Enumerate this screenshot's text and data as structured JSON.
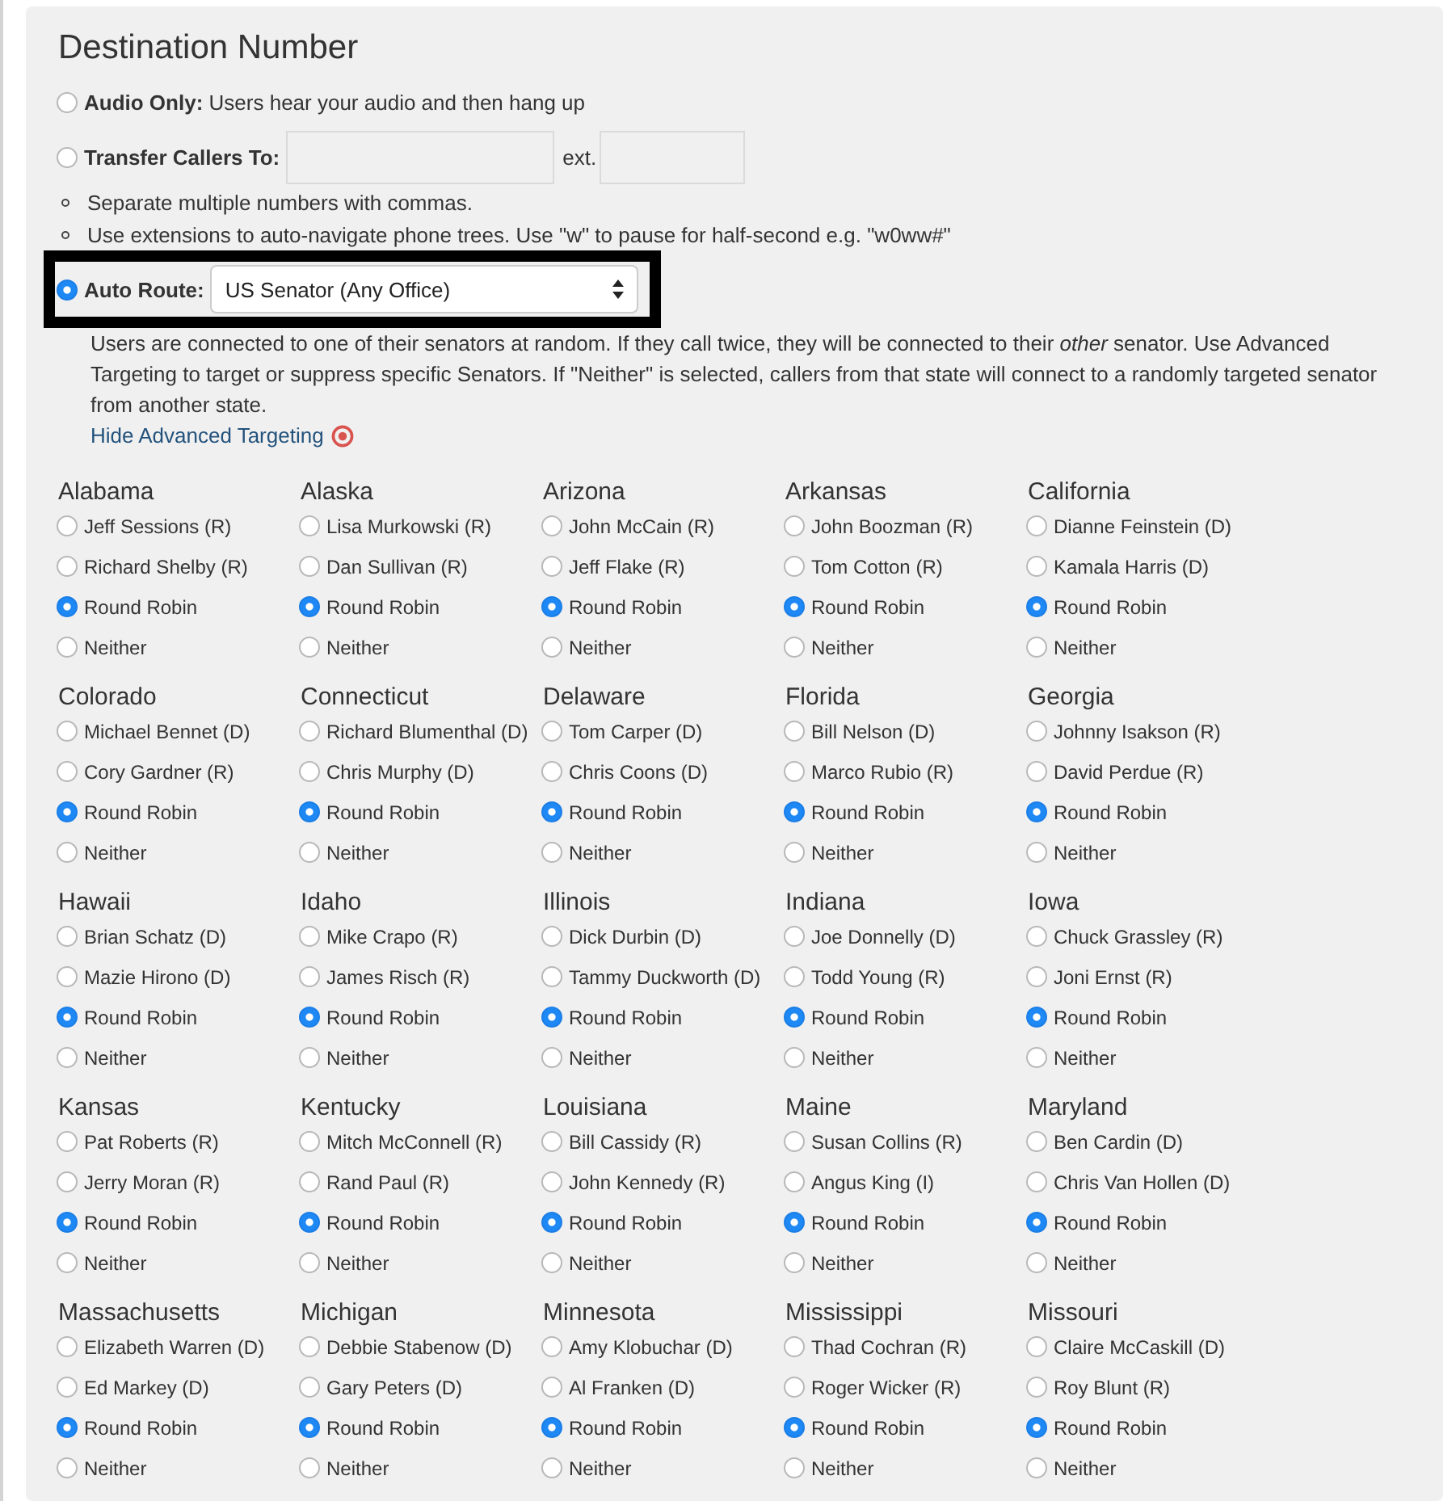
{
  "title": "Destination Number",
  "options": [
    {
      "kind": "plain",
      "label": "Audio Only:",
      "text": "Users hear your audio and then hang up",
      "selected": false
    },
    {
      "kind": "transfer",
      "label": "Transfer Callers To:",
      "ext_label": "ext.",
      "selected": false,
      "notes": [
        "Separate multiple numbers with commas.",
        "Use extensions to auto-navigate phone trees. Use \"w\" to pause for half-second e.g. \"w0ww#\""
      ]
    },
    {
      "kind": "select",
      "label": "Auto Route:",
      "value": "US Senator (Any Office)",
      "selected": true,
      "highlighted": true
    }
  ],
  "description": "Users are connected to one of their senators at random. If they call twice, they will be connected to their *other* senator. Use Advanced Targeting to target or suppress specific Senators. If \"Neither\" is selected, callers from that state will connect to a randomly targeted senator from another state.",
  "targeting_link": "Hide Advanced Targeting",
  "states": [
    {
      "name": "Alabama",
      "choices": [
        {
          "label": "Jeff Sessions (R)",
          "selected": false
        },
        {
          "label": "Richard Shelby (R)",
          "selected": false
        },
        {
          "label": "Round Robin",
          "selected": true
        },
        {
          "label": "Neither",
          "selected": false
        }
      ]
    },
    {
      "name": "Alaska",
      "choices": [
        {
          "label": "Lisa Murkowski (R)",
          "selected": false
        },
        {
          "label": "Dan Sullivan (R)",
          "selected": false
        },
        {
          "label": "Round Robin",
          "selected": true
        },
        {
          "label": "Neither",
          "selected": false
        }
      ]
    },
    {
      "name": "Arizona",
      "choices": [
        {
          "label": "John McCain (R)",
          "selected": false
        },
        {
          "label": "Jeff Flake (R)",
          "selected": false
        },
        {
          "label": "Round Robin",
          "selected": true
        },
        {
          "label": "Neither",
          "selected": false
        }
      ]
    },
    {
      "name": "Arkansas",
      "choices": [
        {
          "label": "John Boozman (R)",
          "selected": false
        },
        {
          "label": "Tom Cotton (R)",
          "selected": false
        },
        {
          "label": "Round Robin",
          "selected": true
        },
        {
          "label": "Neither",
          "selected": false
        }
      ]
    },
    {
      "name": "California",
      "choices": [
        {
          "label": "Dianne Feinstein (D)",
          "selected": false
        },
        {
          "label": "Kamala Harris (D)",
          "selected": false
        },
        {
          "label": "Round Robin",
          "selected": true
        },
        {
          "label": "Neither",
          "selected": false
        }
      ]
    },
    {
      "name": "Colorado",
      "choices": [
        {
          "label": "Michael Bennet (D)",
          "selected": false
        },
        {
          "label": "Cory Gardner (R)",
          "selected": false
        },
        {
          "label": "Round Robin",
          "selected": true
        },
        {
          "label": "Neither",
          "selected": false
        }
      ]
    },
    {
      "name": "Connecticut",
      "choices": [
        {
          "label": "Richard Blumenthal (D)",
          "selected": false
        },
        {
          "label": "Chris Murphy (D)",
          "selected": false
        },
        {
          "label": "Round Robin",
          "selected": true
        },
        {
          "label": "Neither",
          "selected": false
        }
      ]
    },
    {
      "name": "Delaware",
      "choices": [
        {
          "label": "Tom Carper (D)",
          "selected": false
        },
        {
          "label": "Chris Coons (D)",
          "selected": false
        },
        {
          "label": "Round Robin",
          "selected": true
        },
        {
          "label": "Neither",
          "selected": false
        }
      ]
    },
    {
      "name": "Florida",
      "choices": [
        {
          "label": "Bill Nelson (D)",
          "selected": false
        },
        {
          "label": "Marco Rubio (R)",
          "selected": false
        },
        {
          "label": "Round Robin",
          "selected": true
        },
        {
          "label": "Neither",
          "selected": false
        }
      ]
    },
    {
      "name": "Georgia",
      "choices": [
        {
          "label": "Johnny Isakson (R)",
          "selected": false
        },
        {
          "label": "David Perdue (R)",
          "selected": false
        },
        {
          "label": "Round Robin",
          "selected": true
        },
        {
          "label": "Neither",
          "selected": false
        }
      ]
    },
    {
      "name": "Hawaii",
      "choices": [
        {
          "label": "Brian Schatz (D)",
          "selected": false
        },
        {
          "label": "Mazie Hirono (D)",
          "selected": false
        },
        {
          "label": "Round Robin",
          "selected": true
        },
        {
          "label": "Neither",
          "selected": false
        }
      ]
    },
    {
      "name": "Idaho",
      "choices": [
        {
          "label": "Mike Crapo (R)",
          "selected": false
        },
        {
          "label": "James Risch (R)",
          "selected": false
        },
        {
          "label": "Round Robin",
          "selected": true
        },
        {
          "label": "Neither",
          "selected": false
        }
      ]
    },
    {
      "name": "Illinois",
      "choices": [
        {
          "label": "Dick Durbin (D)",
          "selected": false
        },
        {
          "label": "Tammy Duckworth (D)",
          "selected": false
        },
        {
          "label": "Round Robin",
          "selected": true
        },
        {
          "label": "Neither",
          "selected": false
        }
      ]
    },
    {
      "name": "Indiana",
      "choices": [
        {
          "label": "Joe Donnelly (D)",
          "selected": false
        },
        {
          "label": "Todd Young (R)",
          "selected": false
        },
        {
          "label": "Round Robin",
          "selected": true
        },
        {
          "label": "Neither",
          "selected": false
        }
      ]
    },
    {
      "name": "Iowa",
      "choices": [
        {
          "label": "Chuck Grassley (R)",
          "selected": false
        },
        {
          "label": "Joni Ernst (R)",
          "selected": false
        },
        {
          "label": "Round Robin",
          "selected": true
        },
        {
          "label": "Neither",
          "selected": false
        }
      ]
    },
    {
      "name": "Kansas",
      "choices": [
        {
          "label": "Pat Roberts (R)",
          "selected": false
        },
        {
          "label": "Jerry Moran (R)",
          "selected": false
        },
        {
          "label": "Round Robin",
          "selected": true
        },
        {
          "label": "Neither",
          "selected": false
        }
      ]
    },
    {
      "name": "Kentucky",
      "choices": [
        {
          "label": "Mitch McConnell (R)",
          "selected": false
        },
        {
          "label": "Rand Paul (R)",
          "selected": false
        },
        {
          "label": "Round Robin",
          "selected": true
        },
        {
          "label": "Neither",
          "selected": false
        }
      ]
    },
    {
      "name": "Louisiana",
      "choices": [
        {
          "label": "Bill Cassidy (R)",
          "selected": false
        },
        {
          "label": "John Kennedy (R)",
          "selected": false
        },
        {
          "label": "Round Robin",
          "selected": true
        },
        {
          "label": "Neither",
          "selected": false
        }
      ]
    },
    {
      "name": "Maine",
      "choices": [
        {
          "label": "Susan Collins (R)",
          "selected": false
        },
        {
          "label": "Angus King (I)",
          "selected": false
        },
        {
          "label": "Round Robin",
          "selected": true
        },
        {
          "label": "Neither",
          "selected": false
        }
      ]
    },
    {
      "name": "Maryland",
      "choices": [
        {
          "label": "Ben Cardin (D)",
          "selected": false
        },
        {
          "label": "Chris Van Hollen (D)",
          "selected": false
        },
        {
          "label": "Round Robin",
          "selected": true
        },
        {
          "label": "Neither",
          "selected": false
        }
      ]
    },
    {
      "name": "Massachusetts",
      "choices": [
        {
          "label": "Elizabeth Warren (D)",
          "selected": false
        },
        {
          "label": "Ed Markey (D)",
          "selected": false
        },
        {
          "label": "Round Robin",
          "selected": true
        },
        {
          "label": "Neither",
          "selected": false
        }
      ]
    },
    {
      "name": "Michigan",
      "choices": [
        {
          "label": "Debbie Stabenow (D)",
          "selected": false
        },
        {
          "label": "Gary Peters (D)",
          "selected": false
        },
        {
          "label": "Round Robin",
          "selected": true
        },
        {
          "label": "Neither",
          "selected": false
        }
      ]
    },
    {
      "name": "Minnesota",
      "choices": [
        {
          "label": "Amy Klobuchar (D)",
          "selected": false
        },
        {
          "label": "Al Franken (D)",
          "selected": false
        },
        {
          "label": "Round Robin",
          "selected": true
        },
        {
          "label": "Neither",
          "selected": false
        }
      ]
    },
    {
      "name": "Mississippi",
      "choices": [
        {
          "label": "Thad Cochran (R)",
          "selected": false
        },
        {
          "label": "Roger Wicker (R)",
          "selected": false
        },
        {
          "label": "Round Robin",
          "selected": true
        },
        {
          "label": "Neither",
          "selected": false
        }
      ]
    },
    {
      "name": "Missouri",
      "choices": [
        {
          "label": "Claire McCaskill (D)",
          "selected": false
        },
        {
          "label": "Roy Blunt (R)",
          "selected": false
        },
        {
          "label": "Round Robin",
          "selected": true
        },
        {
          "label": "Neither",
          "selected": false
        }
      ]
    }
  ]
}
